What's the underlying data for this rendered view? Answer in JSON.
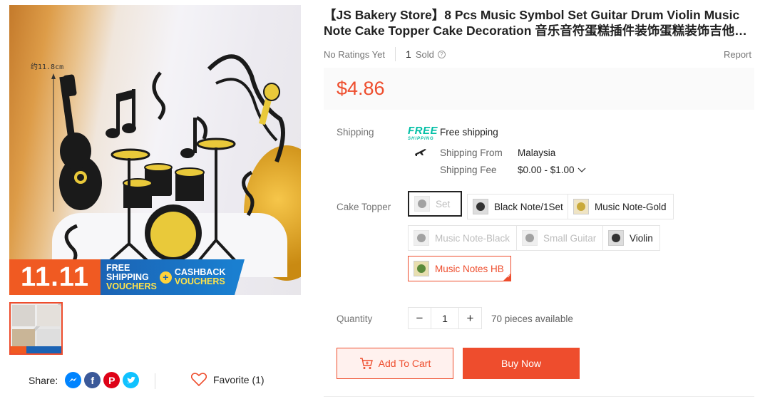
{
  "product": {
    "title": "【JS Bakery Store】8 Pcs Music Symbol Set Guitar Drum Violin Music Note Cake Topper Cake Decoration 音乐音符蛋糕插件装饰蛋糕装饰吉他小提琴乐器",
    "ratings": "No Ratings Yet",
    "sold_count": "1",
    "sold_label": "Sold",
    "report": "Report",
    "price": "$4.86"
  },
  "image": {
    "measure_label": "约11.8cm",
    "banner_1111": "11.11",
    "banner_free_shipping_1": "FREE",
    "banner_free_shipping_2": "SHIPPING",
    "banner_vouchers": "VOUCHERS",
    "banner_cashback": "CASHBACK",
    "banner_plus": "+",
    "colors": {
      "banner_orange": "#f05a22",
      "banner_blue": "#1b63b4",
      "accent": "#ee4d2d"
    }
  },
  "shipping": {
    "label": "Shipping",
    "free_logo_top": "FREE",
    "free_logo_bottom": "SHIPPING",
    "free_text": "Free shipping",
    "from_label": "Shipping From",
    "from_value": "Malaysia",
    "fee_label": "Shipping Fee",
    "fee_value": "$0.00 - $1.00"
  },
  "variations": {
    "label": "Cake Topper",
    "options": [
      {
        "label": "Set",
        "state": "disabled-selected"
      },
      {
        "label": "Black Note/1Set",
        "state": "available"
      },
      {
        "label": "Music Note-Gold",
        "state": "available"
      },
      {
        "label": "Music Note-Black",
        "state": "disabled"
      },
      {
        "label": "Small Guitar",
        "state": "disabled"
      },
      {
        "label": "Violin",
        "state": "available"
      },
      {
        "label": "Music Notes HB",
        "state": "active"
      }
    ]
  },
  "quantity": {
    "label": "Quantity",
    "minus": "−",
    "value": "1",
    "plus": "+",
    "available": "70 pieces available"
  },
  "actions": {
    "add_to_cart": "Add To Cart",
    "buy_now": "Buy Now"
  },
  "social": {
    "share_label": "Share:",
    "favorite": "Favorite (1)",
    "icons": [
      "messenger-icon",
      "facebook-icon",
      "pinterest-icon",
      "twitter-icon"
    ]
  }
}
